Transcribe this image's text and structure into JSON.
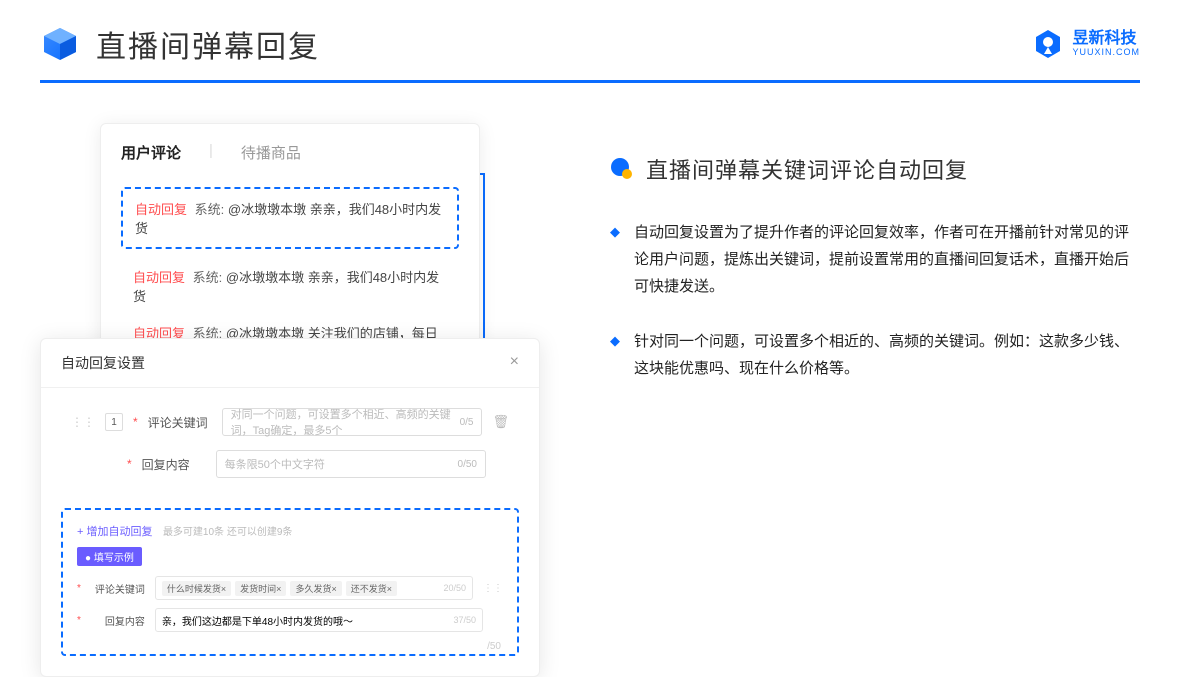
{
  "header": {
    "title": "直播间弹幕回复"
  },
  "logo": {
    "cn": "昱新科技",
    "en": "YUUXIN.COM"
  },
  "comments": {
    "tab_active": "用户评论",
    "tab_other": "待播商品",
    "c1_tag": "自动回复",
    "c1_prefix": "系统:",
    "c1_text": "@冰墩墩本墩 亲亲，我们48小时内发货",
    "c2_tag": "自动回复",
    "c2_prefix": "系统:",
    "c2_text": "@冰墩墩本墩 亲亲，我们48小时内发货",
    "c3_tag": "自动回复",
    "c3_prefix": "系统:",
    "c3_text": "@冰墩墩本墩 关注我们的店铺，每日都有热门推荐呦～"
  },
  "settings": {
    "title": "自动回复设置",
    "idx": "1",
    "label_keyword": "评论关键词",
    "ph_keyword": "对同一个问题，可设置多个相近、高频的关键词，Tag确定，最多5个",
    "cnt_keyword": "0/5",
    "label_content": "回复内容",
    "ph_content": "每条限50个中文字符",
    "cnt_content": "0/50",
    "add_link": "+ 增加自动回复",
    "add_hint": "最多可建10条 还可以创建9条",
    "badge": "● 填写示例",
    "ex_label_keyword": "评论关键词",
    "ex_tags": [
      "什么时候发货×",
      "发货时间×",
      "多久发货×",
      "还不发货×"
    ],
    "ex_cnt_keyword": "20/50",
    "ex_label_content": "回复内容",
    "ex_content": "亲，我们这边都是下单48小时内发货的哦～",
    "ex_cnt_content": "37/50",
    "bottom_cnt": "/50"
  },
  "right": {
    "section_title": "直播间弹幕关键词评论自动回复",
    "b1": "自动回复设置为了提升作者的评论回复效率，作者可在开播前针对常见的评论用户问题，提炼出关键词，提前设置常用的直播间回复话术，直播开始后可快捷发送。",
    "b2": "针对同一个问题，可设置多个相近的、高频的关键词。例如：这款多少钱、这块能优惠吗、现在什么价格等。"
  }
}
